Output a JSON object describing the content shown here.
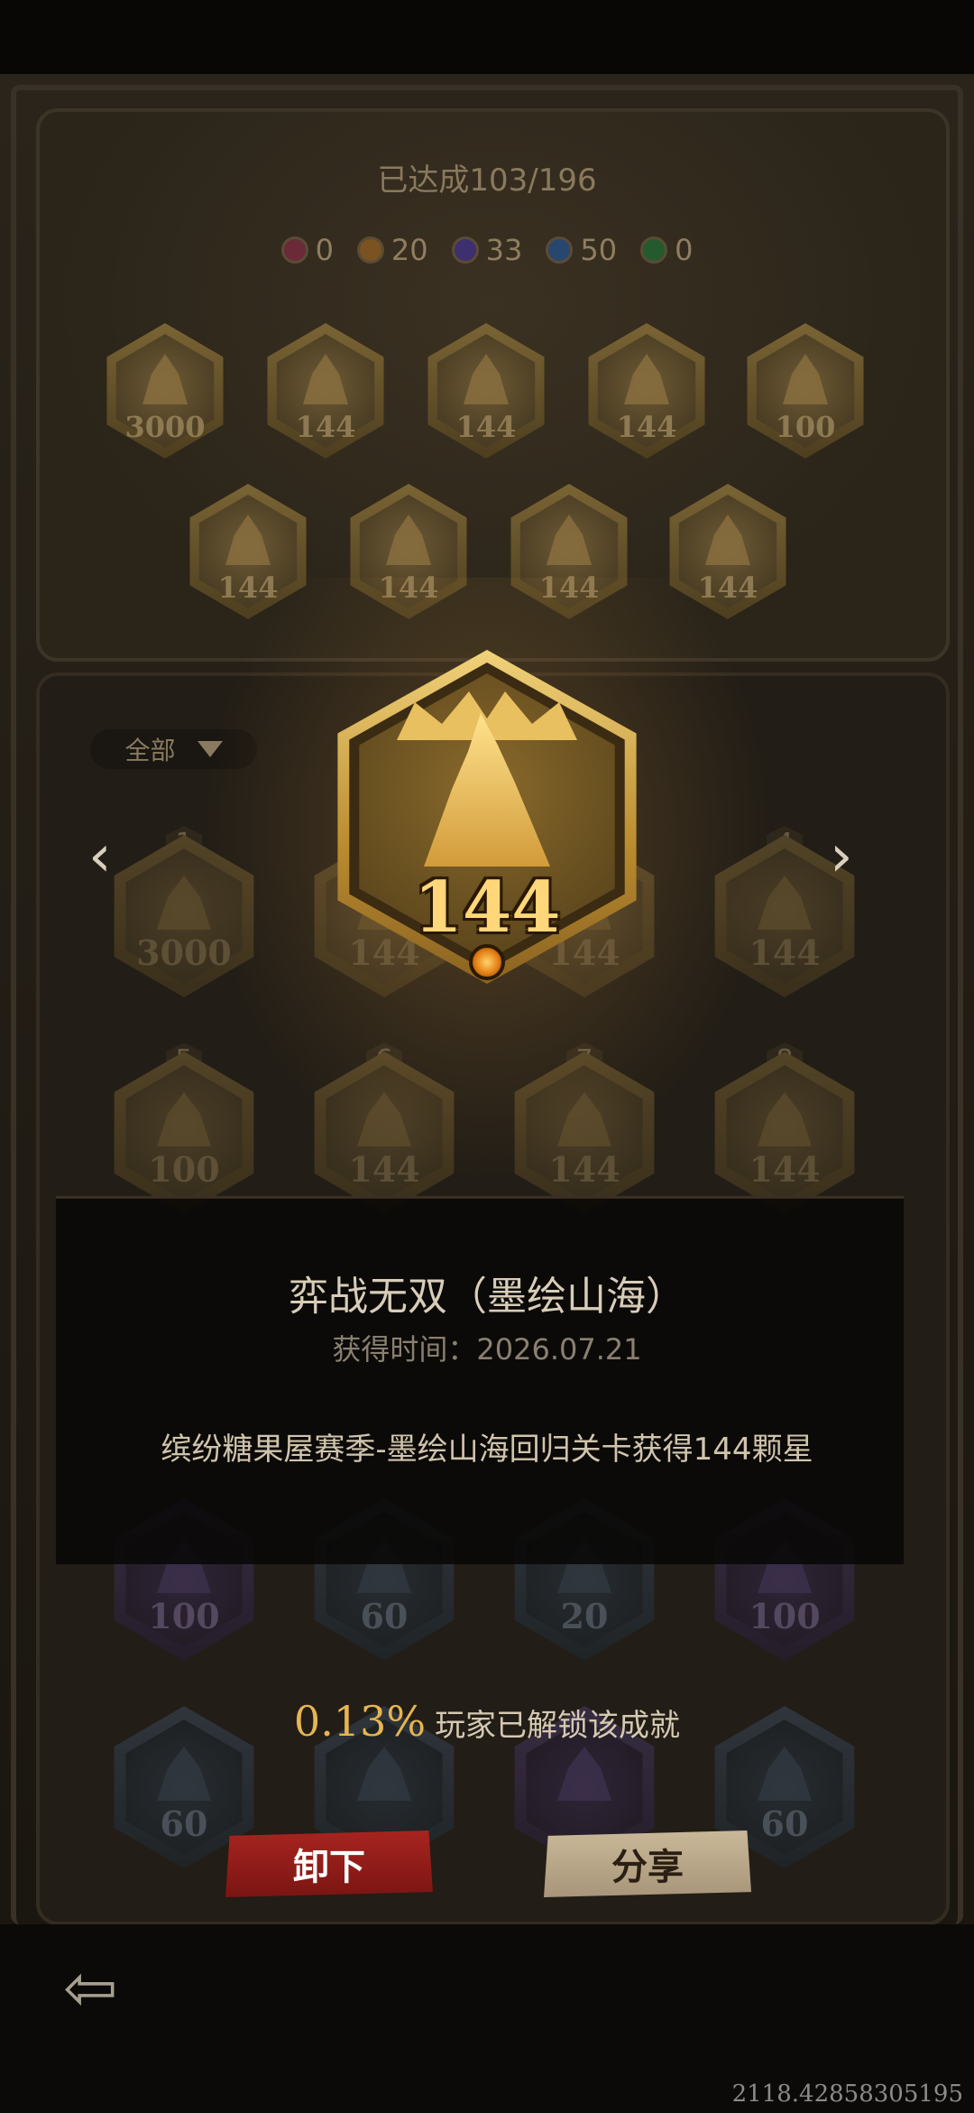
{
  "progress": {
    "label": "已达成103/196"
  },
  "tiers": [
    {
      "name": "red",
      "color": "#c0506a",
      "count": "0"
    },
    {
      "name": "orange",
      "color": "#d48a2a",
      "count": "20"
    },
    {
      "name": "purple",
      "color": "#7a5bc4",
      "count": "33"
    },
    {
      "name": "blue",
      "color": "#3f78c0",
      "count": "50"
    },
    {
      "name": "green",
      "color": "#3d9a4f",
      "count": "0"
    }
  ],
  "equipped": [
    "3000",
    "144",
    "144",
    "144",
    "100",
    "144",
    "144",
    "144",
    "144"
  ],
  "filter": {
    "label": "全部"
  },
  "grid": [
    {
      "index": "1",
      "value": "3000",
      "tier": "gold"
    },
    {
      "index": "",
      "value": "144",
      "tier": "gold"
    },
    {
      "index": "",
      "value": "144",
      "tier": "gold"
    },
    {
      "index": "4",
      "value": "144",
      "tier": "gold"
    },
    {
      "index": "5",
      "value": "100",
      "tier": "gold"
    },
    {
      "index": "6",
      "value": "144",
      "tier": "gold"
    },
    {
      "index": "7",
      "value": "144",
      "tier": "gold"
    },
    {
      "index": "8",
      "value": "144",
      "tier": "gold"
    },
    {
      "index": "",
      "value": "100",
      "tier": "purple"
    },
    {
      "index": "",
      "value": "60",
      "tier": "blue"
    },
    {
      "index": "",
      "value": "20",
      "tier": "blue"
    },
    {
      "index": "",
      "value": "100",
      "tier": "purple"
    },
    {
      "index": "",
      "value": "60",
      "tier": "blue"
    },
    {
      "index": "",
      "value": "",
      "tier": "blue"
    },
    {
      "index": "",
      "value": "",
      "tier": "purple"
    },
    {
      "index": "",
      "value": "60",
      "tier": "blue"
    }
  ],
  "featured": {
    "value": "144"
  },
  "detail": {
    "title": "弈战无双（墨绘山海）",
    "time": "获得时间：2026.07.21",
    "description": "缤纷糖果屋赛季-墨绘山海回归关卡获得144颗星"
  },
  "unlock": {
    "percent": "0.13%",
    "text": "玩家已解锁该成就"
  },
  "buttons": {
    "unequip": "卸下",
    "share": "分享"
  },
  "coords": "2118.428583051​95"
}
